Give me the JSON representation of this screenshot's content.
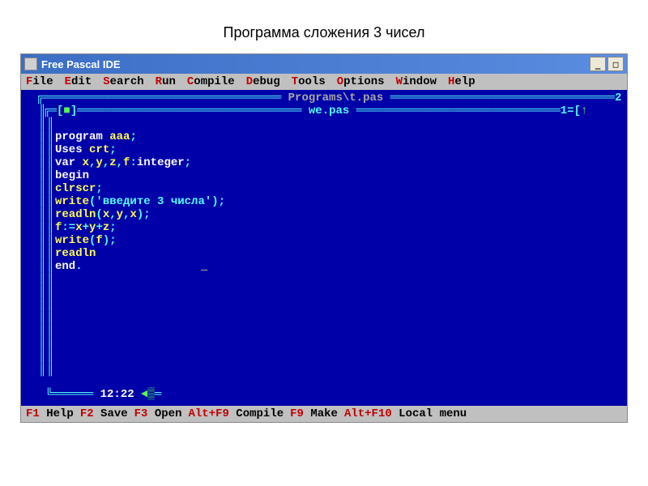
{
  "page": {
    "heading": "Программа сложения 3 чисел"
  },
  "window": {
    "title": "Free Pascal IDE",
    "minimize": "_",
    "maximize": "□"
  },
  "menu": {
    "items": [
      {
        "hot": "F",
        "rest": "ile"
      },
      {
        "hot": "E",
        "rest": "dit"
      },
      {
        "hot": "S",
        "rest": "earch"
      },
      {
        "hot": "R",
        "rest": "un"
      },
      {
        "hot": "C",
        "rest": "ompile"
      },
      {
        "hot": "D",
        "rest": "ebug"
      },
      {
        "hot": "T",
        "rest": "ools"
      },
      {
        "hot": "O",
        "rest": "ptions"
      },
      {
        "hot": "W",
        "rest": "indow"
      },
      {
        "hot": "H",
        "rest": "elp"
      }
    ]
  },
  "editor": {
    "back_file": "Programs\\t.pas",
    "front_file": "we.pas",
    "back_marker_right": "2",
    "front_marker_right": "1=[",
    "clock": "12:22",
    "code": {
      "l1": {
        "kw": "program ",
        "id": "aaa",
        "sym": ";"
      },
      "l2": {
        "kw": "Uses ",
        "id": "crt",
        "sym": ";"
      },
      "l3": {
        "kw": "var ",
        "id": "x",
        "c": ",",
        "id2": "y",
        "c2": ",",
        "id3": "z",
        "c3": ",",
        "id4": "f",
        "col": ":",
        "typ": "integer",
        "sym": ";"
      },
      "l4": {
        "kw": "begin"
      },
      "l5": {
        "id": "clrscr",
        "sym": ";"
      },
      "l6": {
        "id": "write",
        "op": "(",
        "str": "'введите 3 числа'",
        "cp": ")",
        "sym": ";"
      },
      "l7": {
        "id": "readln",
        "op": "(",
        "a": "x",
        "c": ",",
        "b": "y",
        "c2": ",",
        "d": "x",
        "cp": ")",
        "sym": ";"
      },
      "l8": {
        "id": "f",
        "as": ":=",
        "a": "x",
        "p": "+",
        "b": "y",
        "p2": "+",
        "c": "z",
        "sym": ";"
      },
      "l9": {
        "id": "write",
        "op": "(",
        "a": "f",
        "cp": ")",
        "sym": ";"
      },
      "l10": {
        "id": "readln"
      },
      "l11": {
        "kw": "end",
        "dot": "."
      }
    }
  },
  "status": {
    "items": [
      {
        "key": "F1",
        "label": " Help"
      },
      {
        "key": "F2",
        "label": " Save"
      },
      {
        "key": "F3",
        "label": " Open"
      },
      {
        "key": "Alt+F9",
        "label": " Compile"
      },
      {
        "key": "F9",
        "label": " Make"
      },
      {
        "key": "Alt+F10",
        "label": " Local menu"
      }
    ]
  }
}
